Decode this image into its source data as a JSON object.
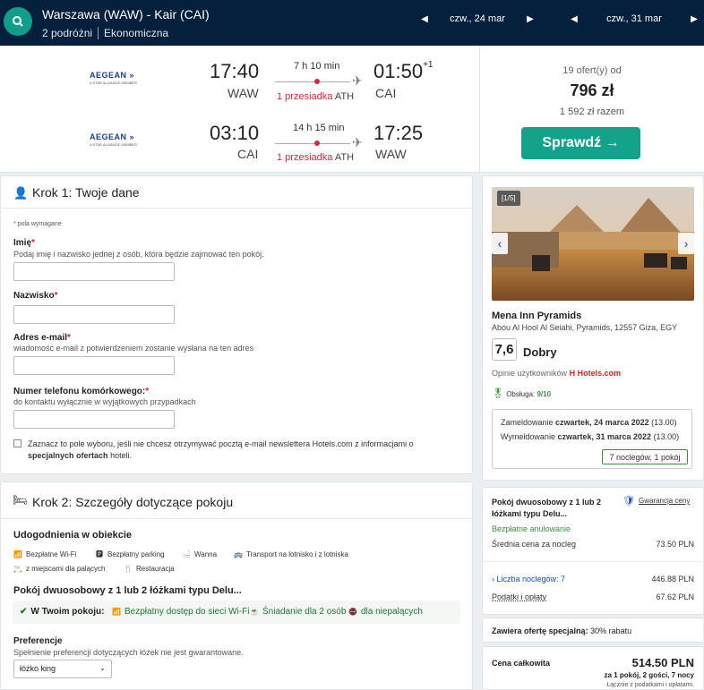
{
  "header": {
    "route": "Warszawa (WAW) - Kair (CAI)",
    "travelers": "2 podróżni",
    "cabin": "Ekonomiczna",
    "depart_date": "czw., 24 mar",
    "return_date": "czw., 31 mar"
  },
  "flights": {
    "outbound": {
      "airline": "AEGEAN",
      "alliance": "A STAR ALLIANCE MEMBER",
      "dep_time": "17:40",
      "dep_code": "WAW",
      "duration": "7 h 10 min",
      "stops": "1 przesiadka",
      "stop_airport": "ATH",
      "arr_time": "01:50",
      "arr_plus": "+1",
      "arr_code": "CAI"
    },
    "inbound": {
      "airline": "AEGEAN",
      "alliance": "A STAR ALLIANCE MEMBER",
      "dep_time": "03:10",
      "dep_code": "CAI",
      "duration": "14 h 15 min",
      "stops": "1 przesiadka",
      "stop_airport": "ATH",
      "arr_time": "17:25",
      "arr_code": "WAW"
    },
    "offers": "19 ofert(y) od",
    "price": "796 zł",
    "total": "1 592 zł razem",
    "check_label": "Sprawdź →"
  },
  "step1": {
    "title": "Krok 1: Twoje dane",
    "required_note": "pola wymagane",
    "first_name_label": "Imię",
    "first_name_hint": "Podaj imię i nazwisko jednej z osób, która będzie zajmować ten pokój.",
    "last_name_label": "Nazwisko",
    "email_label": "Adres e-mail",
    "email_hint": "wiadomość e-mail z potwierdzeniem zostanie wysłana na ten adres",
    "phone_label": "Numer telefonu komórkowego:",
    "phone_hint": "do kontaktu wyłącznie w wyjątkowych przypadkach",
    "newsletter_text_1": "Zaznacz to pole wyboru, jeśli nie chcesz otrzymywać pocztą e-mail newslettera Hotels.com z informacjami o",
    "newsletter_bold": "specjalnych ofertach",
    "newsletter_text_2": "hoteli."
  },
  "step2": {
    "title": "Krok 2: Szczegóły dotyczące pokoju",
    "amenities_title": "Udogodnienia w obiekcie",
    "amenities": [
      {
        "icon": "wifi-icon",
        "label": "Bezpłatne Wi-Fi"
      },
      {
        "icon": "parking-icon",
        "label": "Bezpłatny parking"
      },
      {
        "icon": "bathtub-icon",
        "label": "Wanna"
      },
      {
        "icon": "shuttle-icon",
        "label": "Transport na lotnisko i z lotniska"
      },
      {
        "icon": "smoking-icon",
        "label": "z miejscami dla palących"
      },
      {
        "icon": "restaurant-icon",
        "label": "Restauracja"
      }
    ],
    "room_title": "Pokój dwuosobowy z 1 lub 2 łóżkami typu Delu...",
    "in_room_label": "W Twoim pokoju:",
    "in_room": [
      {
        "icon": "wifi-icon",
        "label": "Bezpłatny dostęp do sieci Wi-Fi"
      },
      {
        "icon": "coffee-icon",
        "label": "Śniadanie dla 2 osób"
      },
      {
        "icon": "no-smoking-icon",
        "label": "dla niepalących"
      }
    ],
    "preferences_label": "Preferencje",
    "preferences_hint": "Spełnienie preferencji dotyczących łóżek nie jest gwarantowane.",
    "bed_selected": "łóżko king"
  },
  "hotel": {
    "image_counter": "[1/5]",
    "name": "Mena Inn Pyramids",
    "address": "Abou Al Hool Al Seiahi, Pyramids, 12557 Giza, EGY",
    "rating": "7,6",
    "rating_label": "Dobry",
    "reviews_label": "Opinie użytkowników",
    "reviews_source": "Hotels.com",
    "service_label": "Obsługa:",
    "service_score": "9/10",
    "checkin_label": "Zameldowanie",
    "checkin_date": "czwartek, 24 marca 2022",
    "checkin_time": "(13.00)",
    "checkout_label": "Wymeldowanie",
    "checkout_date": "czwartek, 31 marca 2022",
    "checkout_time": "(13.00)",
    "nights_summary": "7 noclegów, 1 pokój"
  },
  "pricing": {
    "room_name": "Pokój dwuosobowy z 1 lub 2 łóżkami typu Delu...",
    "guarantee_label": "Gwarancja ceny",
    "free_cancel": "Bezpłatne anulowanie",
    "avg_label": "Średnia cena za nocleg",
    "avg_value": "73.50 PLN",
    "nights_label": "Liczba noclegów: 7",
    "nights_value": "446.88 PLN",
    "taxes_label": "Podatki i opłaty",
    "taxes_value": "67.62 PLN",
    "special_label": "Zawiera ofertę specjalną:",
    "special_value": "30% rabatu",
    "total_label": "Cena całkowita",
    "total_value": "514.50 PLN",
    "total_detail": "za 1 pokój, 2 gości, 7 nocy",
    "total_note": "Łącznie z podatkami i opłatami."
  }
}
